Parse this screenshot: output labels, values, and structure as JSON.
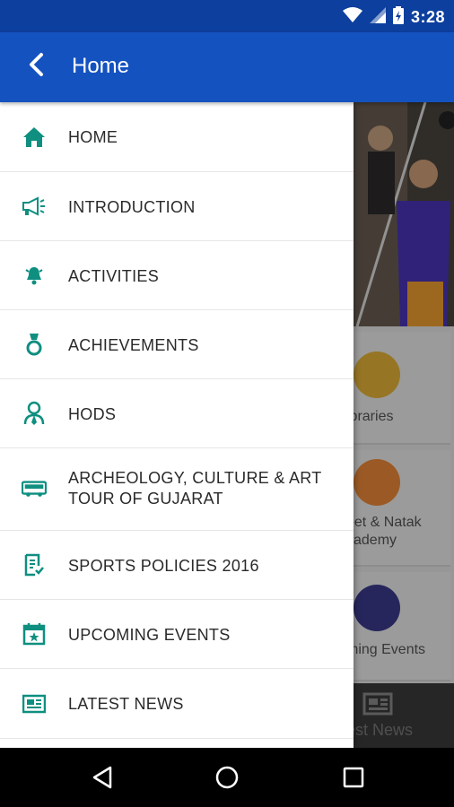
{
  "status_bar": {
    "time": "3:28"
  },
  "app_bar": {
    "title": "Home"
  },
  "menu": {
    "items": [
      {
        "label": "HOME",
        "icon": "home-icon"
      },
      {
        "label": "INTRODUCTION",
        "icon": "megaphone-icon"
      },
      {
        "label": "ACTIVITIES",
        "icon": "bell-icon"
      },
      {
        "label": "ACHIEVEMENTS",
        "icon": "medal-icon"
      },
      {
        "label": "HODS",
        "icon": "person-icon"
      },
      {
        "label": "ARCHEOLOGY, CULTURE & ART TOUR OF GUJARAT",
        "icon": "bus-icon"
      },
      {
        "label": "SPORTS POLICIES 2016",
        "icon": "document-icon"
      },
      {
        "label": "UPCOMING EVENTS",
        "icon": "calendar-icon"
      },
      {
        "label": "LATEST NEWS",
        "icon": "newspaper-icon"
      }
    ]
  },
  "background": {
    "tiles": [
      {
        "label": "ibraries",
        "color": "#e6b53a"
      },
      {
        "label": "eet & Natak",
        "label2": "cademy",
        "color": "#ef8a3a"
      },
      {
        "label": "ming Events",
        "color": "#3b3b8f"
      }
    ],
    "bottom_label": "est News"
  },
  "colors": {
    "primary": "#1452c0",
    "status": "#0d3f9e",
    "icon_accent": "#0e8f80"
  }
}
